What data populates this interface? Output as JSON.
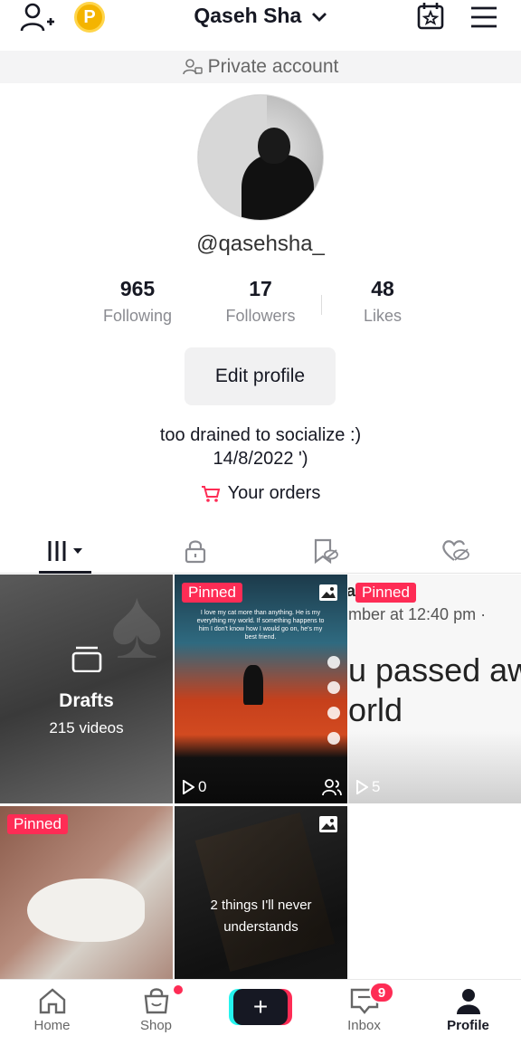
{
  "header": {
    "username": "Qaseh Sha",
    "coin_label": "P"
  },
  "privacy": {
    "label": "Private account"
  },
  "profile": {
    "handle": "@qasehsha_",
    "stats": [
      {
        "value": "965",
        "label": "Following"
      },
      {
        "value": "17",
        "label": "Followers"
      },
      {
        "value": "48",
        "label": "Likes"
      }
    ],
    "edit_label": "Edit profile",
    "bio_line1": "too drained to socialize :)",
    "bio_line2": "14/8/2022 ')",
    "orders_label": "Your orders"
  },
  "grid": {
    "drafts_title": "Drafts",
    "drafts_count": "215 videos",
    "pinned_label": "Pinned",
    "c2_views": "0",
    "c3_views": "5",
    "c3_line": "mber at 12:40 pm ·",
    "c3_big1": "u passed aw",
    "c3_big2": "orld",
    "c3_a": "a",
    "c2_text": "I love my cat more than anything. He is my everything my world. If something happens to him I don't know how I would go on, he's my best friend.",
    "c5_caption": "2 things I'll never understands"
  },
  "nav": {
    "home": "Home",
    "shop": "Shop",
    "create": "+",
    "inbox": "Inbox",
    "inbox_badge": "9",
    "profile": "Profile"
  },
  "colors": {
    "accent": "#fe2c55",
    "cyan": "#25f4ee",
    "coin": "#f4b400"
  }
}
